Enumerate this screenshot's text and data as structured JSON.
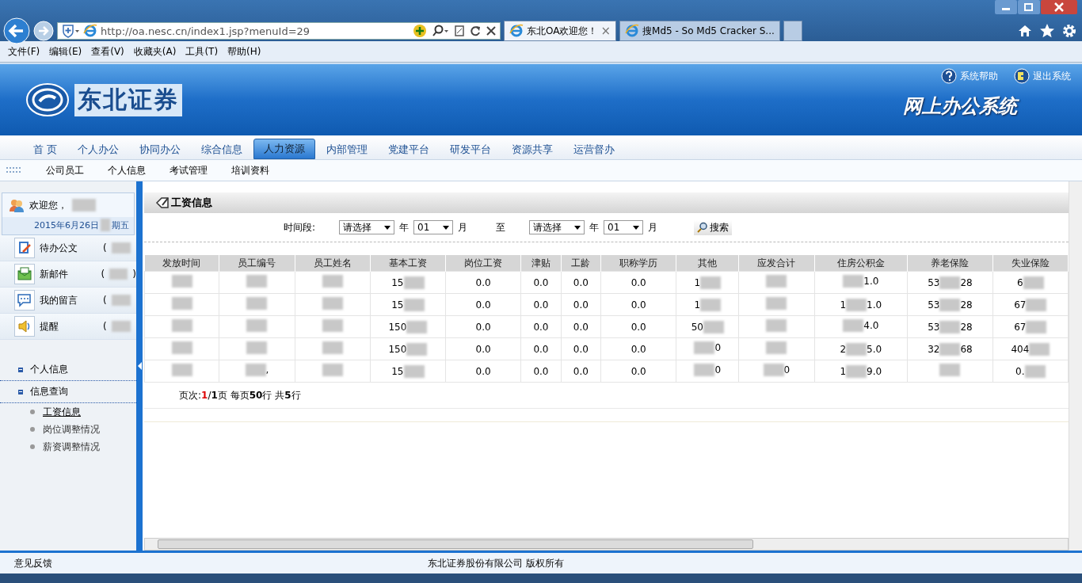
{
  "browser": {
    "url": "http://oa.nesc.cn/index1.jsp?menuId=29",
    "tabs": [
      {
        "title": "东北OA欢迎您！",
        "selected": true,
        "close": "×"
      },
      {
        "title": "搜Md5 - So Md5 Cracker S...",
        "selected": false
      }
    ],
    "menu": [
      "文件(F)",
      "编辑(E)",
      "查看(V)",
      "收藏夹(A)",
      "工具(T)",
      "帮助(H)"
    ]
  },
  "header": {
    "logo": "东北证券",
    "slogan": "网上办公系统",
    "links": [
      {
        "kind": "help",
        "label": "系统帮助"
      },
      {
        "kind": "exit",
        "label": "退出系统"
      }
    ]
  },
  "nav": [
    {
      "label": "首 页",
      "selected": false
    },
    {
      "label": "个人办公",
      "selected": false
    },
    {
      "label": "协同办公",
      "selected": false
    },
    {
      "label": "综合信息",
      "selected": false
    },
    {
      "label": "人力资源",
      "selected": true
    },
    {
      "label": "内部管理",
      "selected": false
    },
    {
      "label": "党建平台",
      "selected": false
    },
    {
      "label": "研发平台",
      "selected": false
    },
    {
      "label": "资源共享",
      "selected": false
    },
    {
      "label": "运营督办",
      "selected": false
    }
  ],
  "subnav": [
    "公司员工",
    "个人信息",
    "考试管理",
    "培训资料"
  ],
  "sidebar": {
    "welcome": "欢迎您，",
    "date": "2015年6月26日",
    "weekday": "期五",
    "shortcuts": [
      {
        "kind": "doc",
        "label": "待办公文",
        "count": "("
      },
      {
        "kind": "mail",
        "label": "新邮件",
        "count": "(",
        "count_end": ")"
      },
      {
        "kind": "chat",
        "label": "我的留言",
        "count": "("
      },
      {
        "kind": "sound",
        "label": "提醒",
        "count": "("
      }
    ],
    "tree": [
      {
        "label": "个人信息"
      },
      {
        "label": "信息查询",
        "children": [
          {
            "label": "工资信息",
            "selected": true
          },
          {
            "label": "岗位调整情况",
            "selected": false
          },
          {
            "label": "薪资调整情况",
            "selected": false
          }
        ]
      }
    ]
  },
  "panel": {
    "title": "工资信息",
    "filter": {
      "label": "时间段:",
      "from_year": "请选择",
      "year_unit": "年",
      "from_month": "01",
      "month_unit": "月",
      "to": "至",
      "to_year": "请选择",
      "to_year_unit": "年",
      "to_month": "01",
      "to_month_unit": "月",
      "search": "搜索"
    },
    "table": {
      "columns": [
        "发放时间",
        "员工编号",
        "员工姓名",
        "基本工资",
        "岗位工资",
        "津贴",
        "工龄",
        "职称学历",
        "其他",
        "应发合计",
        "住房公积金",
        "养老保险",
        "失业保险"
      ],
      "rows": [
        [
          {
            "redacted": true
          },
          {
            "redacted": true
          },
          {
            "redacted": true
          },
          {
            "text": "15",
            "redacted": true
          },
          {
            "text": "0.0",
            "redacted": false
          },
          {
            "text": "0.0",
            "redacted": false
          },
          {
            "text": "0.0",
            "redacted": false
          },
          {
            "text": "0.0",
            "redacted": false
          },
          {
            "text": "1",
            "redacted": true
          },
          {
            "redacted": true
          },
          {
            "redacted": true,
            "after": "1.0"
          },
          {
            "text": "53",
            "redacted": true,
            "after": "28"
          },
          {
            "text": "6",
            "redacted": true
          }
        ],
        [
          {
            "redacted": true
          },
          {
            "redacted": true
          },
          {
            "redacted": true
          },
          {
            "text": "15",
            "redacted": true
          },
          {
            "text": "0.0",
            "redacted": false
          },
          {
            "text": "0.0",
            "redacted": false
          },
          {
            "text": "0.0",
            "redacted": false
          },
          {
            "text": "0.0",
            "redacted": false
          },
          {
            "text": "1",
            "redacted": true
          },
          {
            "redacted": true
          },
          {
            "text": "1",
            "redacted": true,
            "after": "1.0"
          },
          {
            "text": "53",
            "redacted": true,
            "after": "28"
          },
          {
            "text": "67",
            "redacted": true
          }
        ],
        [
          {
            "redacted": true
          },
          {
            "redacted": true
          },
          {
            "redacted": true
          },
          {
            "text": "150",
            "redacted": true
          },
          {
            "text": "0.0",
            "redacted": false
          },
          {
            "text": "0.0",
            "redacted": false
          },
          {
            "text": "0.0",
            "redacted": false
          },
          {
            "text": "0.0",
            "redacted": false
          },
          {
            "text": "50",
            "redacted": true
          },
          {
            "redacted": true
          },
          {
            "redacted": true,
            "after": "4.0"
          },
          {
            "text": "53",
            "redacted": true,
            "after": "28"
          },
          {
            "text": "67",
            "redacted": true
          }
        ],
        [
          {
            "redacted": true
          },
          {
            "redacted": true
          },
          {
            "redacted": true
          },
          {
            "text": "150",
            "redacted": true
          },
          {
            "text": "0.0",
            "redacted": false
          },
          {
            "text": "0.0",
            "redacted": false
          },
          {
            "text": "0.0",
            "redacted": false
          },
          {
            "text": "0.0",
            "redacted": false
          },
          {
            "redacted": true,
            "after": "0"
          },
          {
            "redacted": true
          },
          {
            "text": "2",
            "redacted": true,
            "after": "5.0"
          },
          {
            "text": "32",
            "redacted": true,
            "after": "68"
          },
          {
            "text": "404",
            "redacted": true
          }
        ],
        [
          {
            "redacted": true
          },
          {
            "redacted": true,
            "after": ","
          },
          {
            "redacted": true
          },
          {
            "text": "15",
            "redacted": true
          },
          {
            "text": "0.0",
            "redacted": false
          },
          {
            "text": "0.0",
            "redacted": false
          },
          {
            "text": "0.0",
            "redacted": false
          },
          {
            "text": "0.0",
            "redacted": false
          },
          {
            "redacted": true,
            "after": "0"
          },
          {
            "redacted": true,
            "after": "0"
          },
          {
            "text": "1",
            "redacted": true,
            "after": "9.0"
          },
          {
            "redacted": true
          },
          {
            "text": "0.",
            "redacted": true
          }
        ]
      ]
    },
    "pager": "页次:**1**/**1**页  每页**50**行  共**5**行"
  },
  "footer": {
    "feedback": "意见反馈",
    "copyright": "东北证券股份有限公司  版权所有"
  }
}
